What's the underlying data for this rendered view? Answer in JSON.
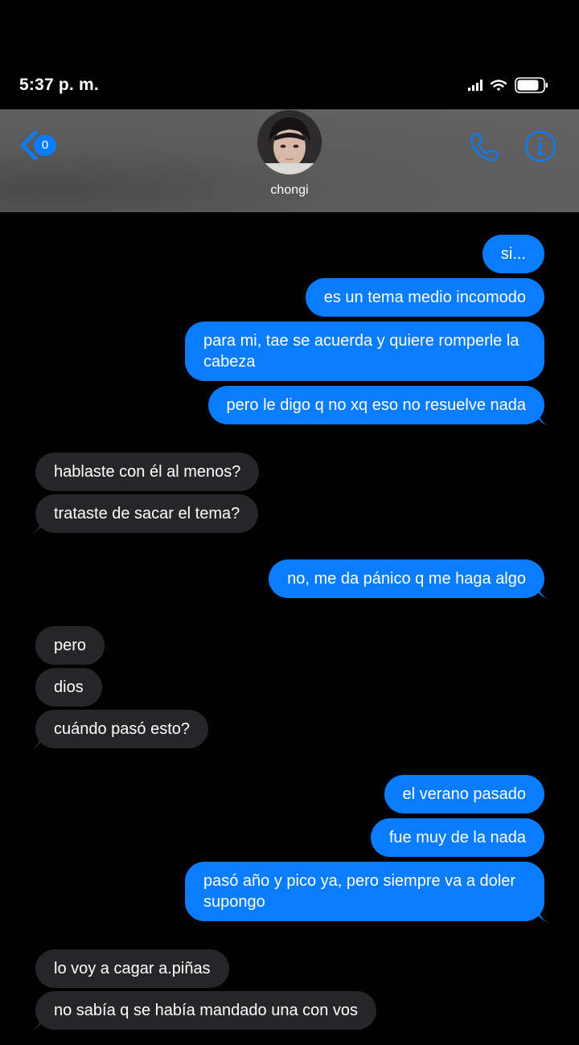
{
  "status_bar": {
    "time": "5:37 p. m."
  },
  "header": {
    "back_badge": "0",
    "contact_name": "chongi"
  },
  "messages": [
    {
      "side": "sent",
      "text": "si..."
    },
    {
      "side": "sent",
      "text": "es un tema medio incomodo"
    },
    {
      "side": "sent",
      "text": "para mi, tae se acuerda y quiere romperle la cabeza"
    },
    {
      "side": "sent",
      "text": "pero le digo q no xq eso no resuelve nada"
    },
    {
      "side": "recv",
      "text": "hablaste con él al menos?"
    },
    {
      "side": "recv",
      "text": "trataste de sacar el tema?"
    },
    {
      "side": "sent",
      "text": "no, me da pánico q me haga algo"
    },
    {
      "side": "recv",
      "text": "pero"
    },
    {
      "side": "recv",
      "text": "dios"
    },
    {
      "side": "recv",
      "text": "cuándo pasó esto?"
    },
    {
      "side": "sent",
      "text": "el verano pasado"
    },
    {
      "side": "sent",
      "text": "fue muy de la nada"
    },
    {
      "side": "sent",
      "text": "pasó año y pico ya, pero siempre va a doler supongo"
    },
    {
      "side": "recv",
      "text": "lo voy a cagar a.piñas"
    },
    {
      "side": "recv",
      "text": "no sabía q se había mandado una con vos"
    }
  ],
  "colors": {
    "sent_bubble": "#0a7cff",
    "received_bubble": "#262628",
    "background": "#000000",
    "accent": "#0a7cff"
  },
  "icons": [
    "signal-icon",
    "wifi-icon",
    "battery-icon",
    "back-chevron-icon",
    "phone-icon",
    "info-icon"
  ]
}
